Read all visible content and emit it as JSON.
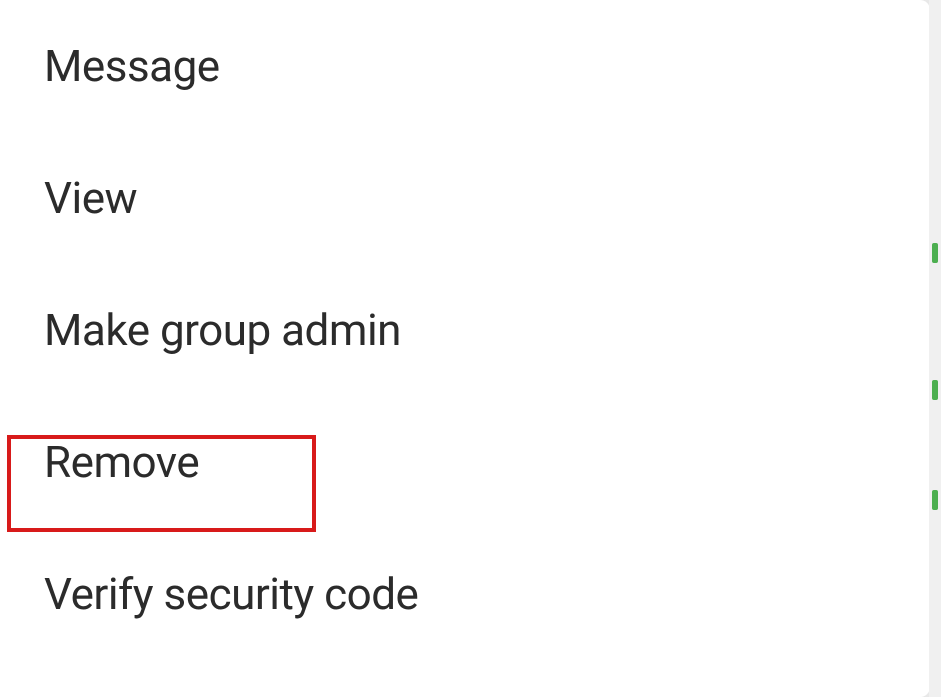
{
  "menu": {
    "items": [
      {
        "label": "Message"
      },
      {
        "label": "View "
      },
      {
        "label": "Make group admin"
      },
      {
        "label": "Remove "
      },
      {
        "label": "Verify security code"
      }
    ]
  },
  "highlighted_index": 3
}
